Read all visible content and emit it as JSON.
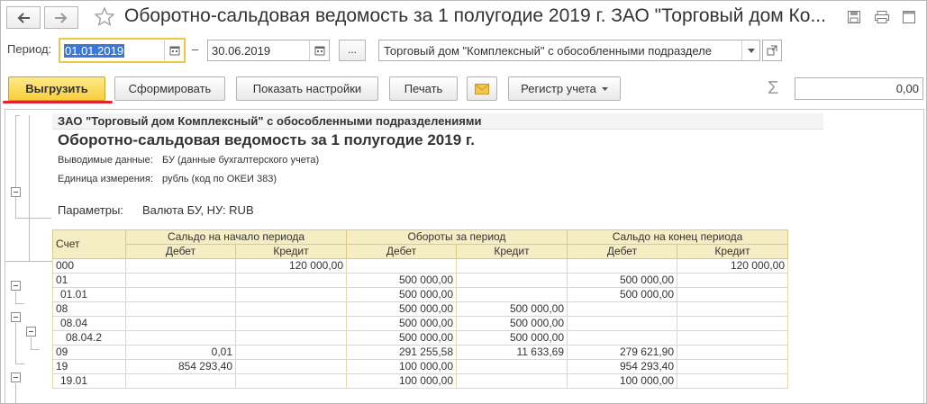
{
  "window": {
    "title": "Оборотно-сальдовая ведомость за 1 полугодие 2019 г. ЗАО \"Торговый дом Ко..."
  },
  "period": {
    "label": "Период:",
    "from": "01.01.2019",
    "dash": "–",
    "to": "30.06.2019",
    "dots": "...",
    "organization": "Торговый дом \"Комплексный\" с обособленными подразделе"
  },
  "toolbar": {
    "export": "Выгрузить",
    "generate": "Сформировать",
    "show_settings": "Показать настройки",
    "print": "Печать",
    "registry": "Регистр учета",
    "sigma": "Σ",
    "sum": "0,00"
  },
  "report": {
    "organization": "ЗАО \"Торговый дом Комплексный\" с обособленными подразделениями",
    "title": "Оборотно-сальдовая ведомость за 1 полугодие 2019 г.",
    "data_label": "Выводимые данные:",
    "data_value": "БУ (данные бухгалтерского учета)",
    "unit_label": "Единица измерения:",
    "unit_value": "рубль (код по ОКЕИ 383)",
    "params_label": "Параметры:",
    "params_value": "Валюта БУ, НУ: RUB",
    "headers": {
      "account": "Счет",
      "opening": "Сальдо на начало периода",
      "turnover": "Обороты за период",
      "closing": "Сальдо на конец периода",
      "debit": "Дебет",
      "credit": "Кредит"
    },
    "rows": [
      {
        "account": "000",
        "level": 0,
        "open_d": "",
        "open_c": "120 000,00",
        "turn_d": "",
        "turn_c": "",
        "close_d": "",
        "close_c": "120 000,00"
      },
      {
        "account": "01",
        "level": 0,
        "open_d": "",
        "open_c": "",
        "turn_d": "500 000,00",
        "turn_c": "",
        "close_d": "500 000,00",
        "close_c": ""
      },
      {
        "account": "01.01",
        "level": 1,
        "open_d": "",
        "open_c": "",
        "turn_d": "500 000,00",
        "turn_c": "",
        "close_d": "500 000,00",
        "close_c": ""
      },
      {
        "account": "08",
        "level": 0,
        "open_d": "",
        "open_c": "",
        "turn_d": "500 000,00",
        "turn_c": "500 000,00",
        "close_d": "",
        "close_c": ""
      },
      {
        "account": "08.04",
        "level": 1,
        "open_d": "",
        "open_c": "",
        "turn_d": "500 000,00",
        "turn_c": "500 000,00",
        "close_d": "",
        "close_c": ""
      },
      {
        "account": "08.04.2",
        "level": 2,
        "open_d": "",
        "open_c": "",
        "turn_d": "500 000,00",
        "turn_c": "500 000,00",
        "close_d": "",
        "close_c": ""
      },
      {
        "account": "09",
        "level": 0,
        "open_d": "0,01",
        "open_c": "",
        "turn_d": "291 255,58",
        "turn_c": "11 633,69",
        "close_d": "279 621,90",
        "close_c": ""
      },
      {
        "account": "19",
        "level": 0,
        "open_d": "854 293,40",
        "open_c": "",
        "turn_d": "100 000,00",
        "turn_c": "",
        "close_d": "954 293,40",
        "close_c": ""
      },
      {
        "account": "19.01",
        "level": 1,
        "open_d": "",
        "open_c": "",
        "turn_d": "100 000,00",
        "turn_c": "",
        "close_d": "100 000,00",
        "close_c": ""
      }
    ]
  },
  "colors": {
    "primary_button": "#f8d03c",
    "active_field_border": "#f0c73d",
    "selection": "#3a78d8",
    "table_header": "#f5edc4",
    "underline": "#e0262a"
  },
  "icons": [
    "back-arrow-icon",
    "forward-arrow-icon",
    "star-icon",
    "save-icon",
    "print-icon",
    "fullscreen-icon",
    "more-icon",
    "close-icon",
    "calendar-icon",
    "dropdown-arrow-icon",
    "open-icon",
    "envelope-icon",
    "collapse-icon"
  ]
}
